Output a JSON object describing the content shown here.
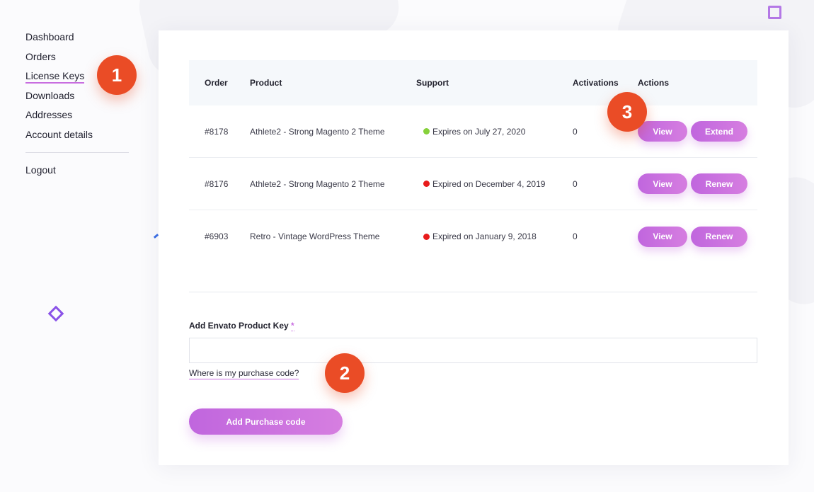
{
  "sidebar": {
    "items": [
      {
        "label": "Dashboard"
      },
      {
        "label": "Orders"
      },
      {
        "label": "License Keys"
      },
      {
        "label": "Downloads"
      },
      {
        "label": "Addresses"
      },
      {
        "label": "Account details"
      }
    ],
    "logout": "Logout"
  },
  "badges": {
    "one": "1",
    "two": "2",
    "three": "3"
  },
  "table": {
    "headers": {
      "order": "Order",
      "product": "Product",
      "support": "Support",
      "activations": "Activations",
      "actions": "Actions"
    },
    "rows": [
      {
        "order": "#8178",
        "product": "Athlete2 - Strong Magento 2 Theme",
        "support": "Expires on July 27, 2020",
        "status": "active",
        "activations": "0",
        "view": "View",
        "action": "Extend"
      },
      {
        "order": "#8176",
        "product": "Athlete2 - Strong Magento 2 Theme",
        "support": "Expired on December 4, 2019",
        "status": "expired",
        "activations": "0",
        "view": "View",
        "action": "Renew"
      },
      {
        "order": "#6903",
        "product": "Retro - Vintage WordPress Theme",
        "support": "Expired on January 9, 2018",
        "status": "expired",
        "activations": "0",
        "view": "View",
        "action": "Renew"
      }
    ]
  },
  "form": {
    "label": "Add Envato Product Key",
    "required_mark": "*",
    "input_value": "",
    "help_link": "Where is my purchase code?",
    "submit": "Add Purchase code"
  },
  "colors": {
    "accent": "#c86de0",
    "badge": "#ea4c26",
    "active_dot": "#86d13a",
    "expired_dot": "#e81b1b"
  }
}
